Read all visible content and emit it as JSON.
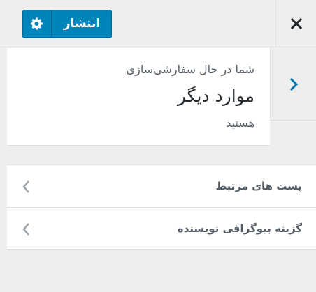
{
  "header": {
    "publish_label": "انتشار",
    "gear_icon": "gear-icon",
    "close_icon": "close-icon",
    "accent_color": "#0085ba"
  },
  "info": {
    "subtitle": "شما در حال سفارشی‌سازی",
    "title": "موارد دیگر",
    "tail": "هستید",
    "back_icon": "chevron-right-icon"
  },
  "sections": [
    {
      "label": "پست های مرتبط",
      "icon": "chevron-left-icon"
    },
    {
      "label": "گزینه بیوگرافی نویسنده",
      "icon": "chevron-left-icon"
    }
  ]
}
